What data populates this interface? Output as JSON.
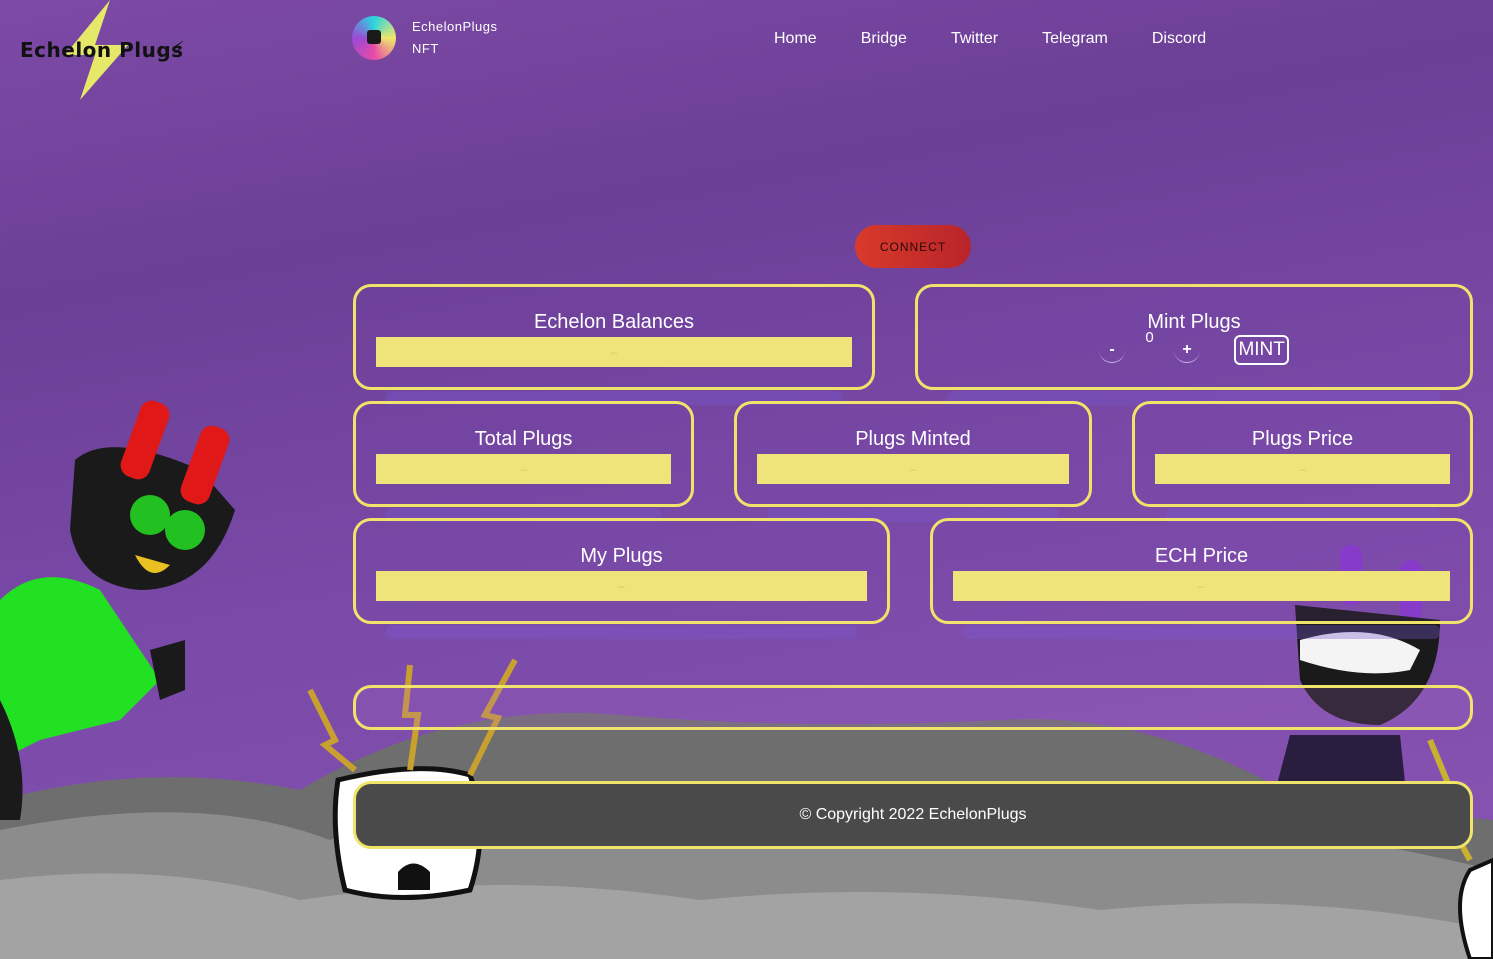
{
  "header": {
    "logo_text": "Echelon Plugs",
    "brand_name": "EchelonPlugs",
    "brand_sub": "NFT",
    "nav": [
      "Home",
      "Bridge",
      "Twitter",
      "Telegram",
      "Discord"
    ]
  },
  "connect_label": "CONNECT",
  "cards": {
    "balances": {
      "title": "Echelon Balances",
      "value": "–"
    },
    "mint": {
      "title": "Mint Plugs",
      "qty": "0",
      "minus": "-",
      "plus": "+",
      "mint_label": "MINT"
    },
    "total": {
      "title": "Total Plugs",
      "value": "–"
    },
    "minted": {
      "title": "Plugs Minted",
      "value": "–"
    },
    "price": {
      "title": "Plugs Price",
      "value": "–"
    },
    "my": {
      "title": "My Plugs",
      "value": "–"
    },
    "ech": {
      "title": "ECH Price",
      "value": "–"
    }
  },
  "footer": {
    "copyright": "© Copyright 2022 EchelonPlugs"
  },
  "colors": {
    "accent": "#f0e36a",
    "bar": "#efe47a",
    "connect": "#d93a2a"
  }
}
